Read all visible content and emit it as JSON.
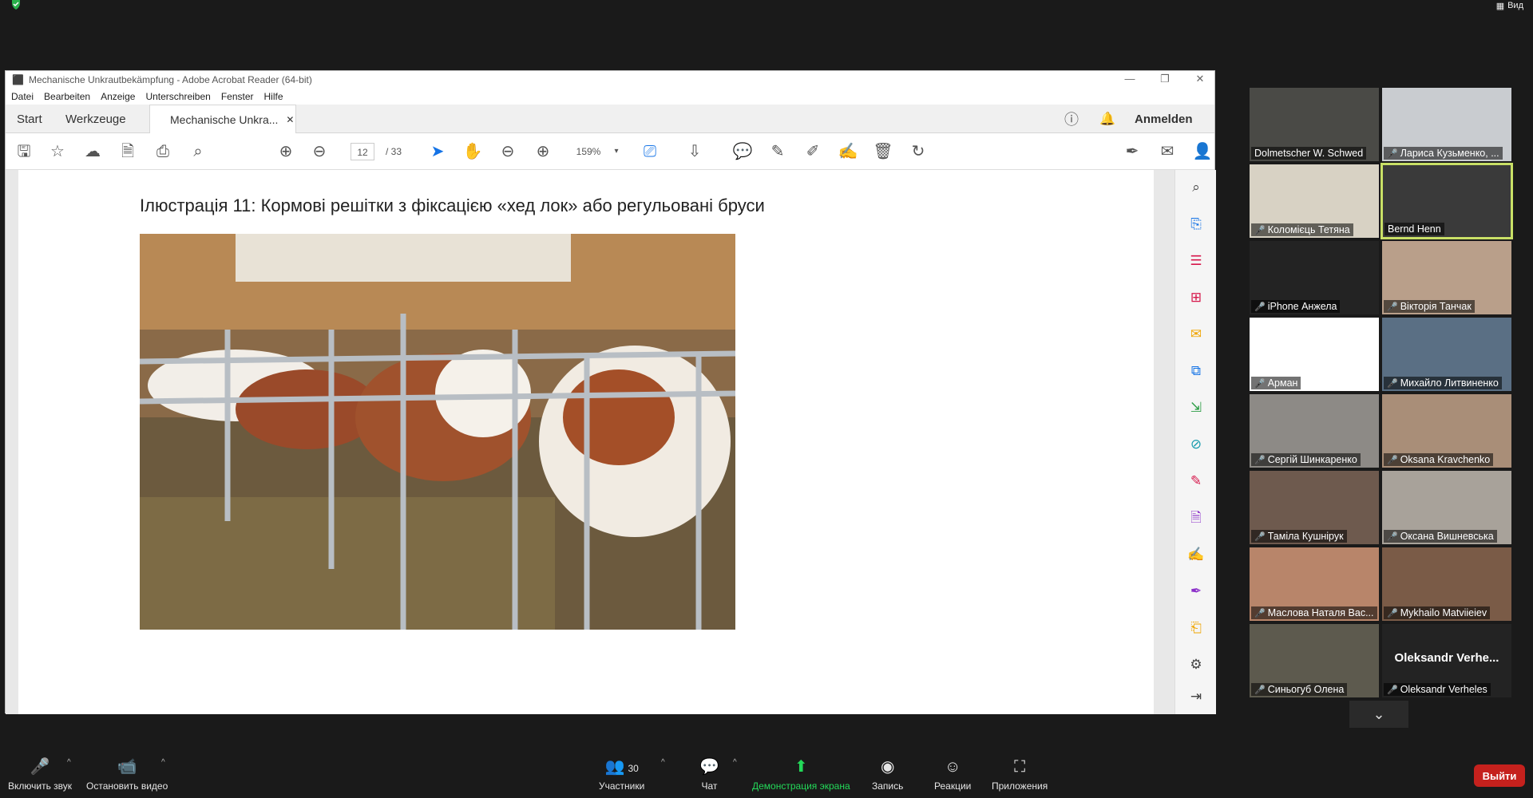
{
  "top_bar": {
    "view_label": "Вид"
  },
  "acrobat": {
    "title": "Mechanische Unkrautbekämpfung - Adobe Acrobat Reader (64-bit)",
    "menu": [
      "Datei",
      "Bearbeiten",
      "Anzeige",
      "Unterschreiben",
      "Fenster",
      "Hilfe"
    ],
    "tabs": {
      "start": "Start",
      "tools": "Werkzeuge",
      "document": "Mechanische Unkra..."
    },
    "sign_in": "Anmelden",
    "page_current": "12",
    "page_total": "/ 33",
    "zoom": "159%",
    "page_heading": "Ілюстрація 11: Кормові решітки з фіксацією «хед  лок» або регульовані бруси"
  },
  "participants": [
    {
      "name": "Dolmetscher  W. Schwed",
      "muted": false
    },
    {
      "name": "Лариса Кузьменко, ...",
      "muted": true
    },
    {
      "name": "Коломієць Тетяна",
      "muted": true
    },
    {
      "name": "Bernd Henn",
      "muted": false,
      "active": true
    },
    {
      "name": "iPhone Анжела",
      "muted": true
    },
    {
      "name": "Вікторія Танчак",
      "muted": true
    },
    {
      "name": "Арман",
      "muted": true
    },
    {
      "name": "Михайло Литвиненко",
      "muted": true
    },
    {
      "name": "Сергій Шинкаренко",
      "muted": true
    },
    {
      "name": "Oksana Kravchenko",
      "muted": true
    },
    {
      "name": "Таміла Кушнірук",
      "muted": true
    },
    {
      "name": "Оксана Вишневська",
      "muted": true
    },
    {
      "name": "Маслова Наталя Вас...",
      "muted": true
    },
    {
      "name": "Mykhailo Matviieiev",
      "muted": true
    },
    {
      "name": "Синьогуб Олена",
      "muted": true
    },
    {
      "name": "Oleksandr Verheles",
      "muted": true,
      "big_label": "Oleksandr  Verhe..."
    }
  ],
  "bottom_bar": {
    "unmute": "Включить звук",
    "stop_video": "Остановить видео",
    "participants_count": "30",
    "participants": "Участники",
    "chat": "Чат",
    "share": "Демонстрация экрана",
    "record": "Запись",
    "reactions": "Реакции",
    "apps": "Приложения",
    "leave": "Выйти"
  },
  "colors": {
    "share_green": "#23d959",
    "leave_red": "#c5211d",
    "active_border": "#c9e066",
    "mic_off": "#e0382f"
  }
}
